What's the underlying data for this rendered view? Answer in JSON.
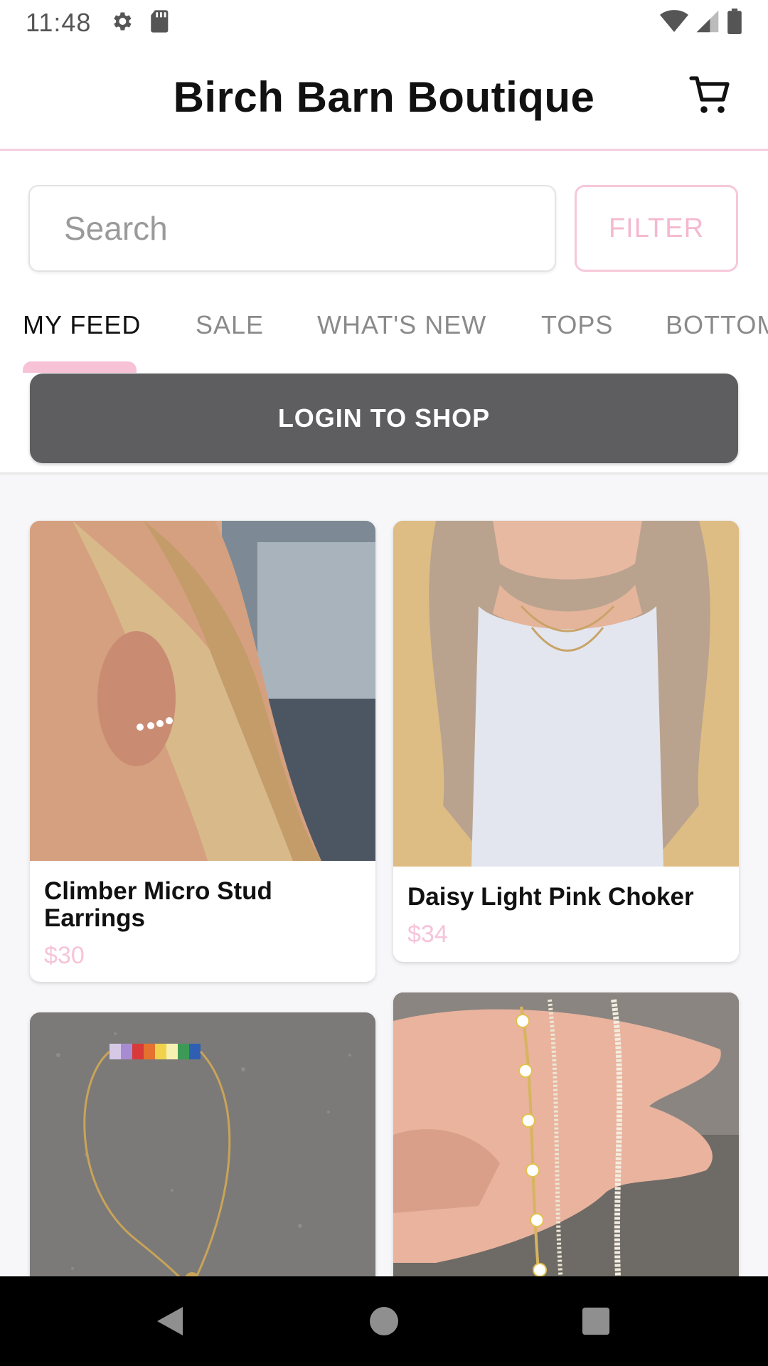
{
  "status_bar": {
    "time": "11:48",
    "left_icons": [
      "gear-icon",
      "sd-card-icon"
    ],
    "right_icons": [
      "wifi-icon",
      "signal-icon",
      "battery-icon"
    ]
  },
  "header": {
    "title": "Birch Barn Boutique",
    "cart_icon": "cart-icon"
  },
  "search": {
    "placeholder": "Search",
    "value": "",
    "filter_label": "FILTER"
  },
  "tabs": [
    {
      "label": "MY FEED",
      "active": true
    },
    {
      "label": "SALE",
      "active": false
    },
    {
      "label": "WHAT'S NEW",
      "active": false
    },
    {
      "label": "TOPS",
      "active": false
    },
    {
      "label": "BOTTOMS",
      "active": false
    }
  ],
  "login_banner": {
    "label": "LOGIN TO SHOP"
  },
  "products": [
    {
      "name": "Climber Micro Stud Earrings",
      "price": "$30",
      "image": "earring-on-ear-photo"
    },
    {
      "name": "Daisy Light Pink Choker",
      "price": "$34",
      "image": "necklace-on-model-photo"
    },
    {
      "name": "",
      "price": "",
      "image": "rainbow-bracelet-photo"
    },
    {
      "name": "",
      "price": "",
      "image": "daisy-necklaces-in-hand-photo"
    }
  ],
  "colors": {
    "accent_pink": "#f6c4d8",
    "login_bg": "#5e5d60",
    "nav_bg": "#000000"
  },
  "nav_bar": {
    "icons": [
      "back-icon",
      "home-icon",
      "recents-icon"
    ]
  }
}
